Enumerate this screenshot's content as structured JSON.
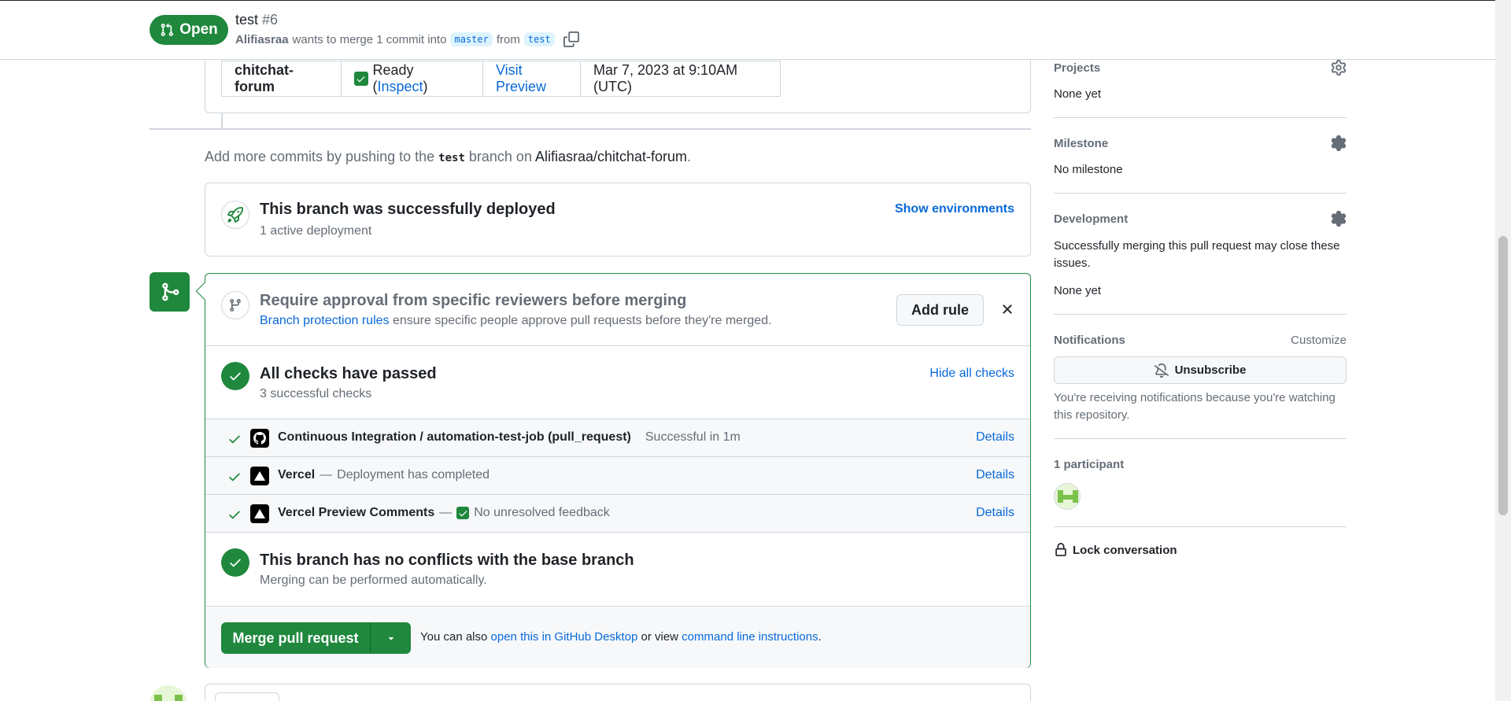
{
  "header": {
    "state": "Open",
    "title": "test",
    "number": "#6",
    "author": "Alifiasraa",
    "merge_text": "wants to merge 1 commit into",
    "base_branch": "master",
    "from_text": "from",
    "head_branch": "test"
  },
  "deployment_table": {
    "name": "chitchat-forum",
    "status_prefix": "Ready (",
    "inspect": "Inspect",
    "status_suffix": ")",
    "visit_preview": "Visit Preview",
    "date": "Mar 7, 2023 at 9:10AM (UTC)"
  },
  "push_hint": {
    "prefix": "Add more commits by pushing to the",
    "branch": "test",
    "middle": "branch on",
    "repo": "Alifiasraa/chitchat-forum",
    "suffix": "."
  },
  "deployed": {
    "title": "This branch was successfully deployed",
    "subtitle": "1 active deployment",
    "show_environments": "Show environments"
  },
  "rule": {
    "title": "Require approval from specific reviewers before merging",
    "link": "Branch protection rules",
    "description": "ensure specific people approve pull requests before they're merged.",
    "add_rule": "Add rule"
  },
  "checks": {
    "title": "All checks have passed",
    "subtitle": "3 successful checks",
    "hide_all": "Hide all checks",
    "rows": [
      {
        "name": "Continuous Integration / automation-test-job (pull_request)",
        "separator": "",
        "status": "Successful in 1m",
        "details": "Details"
      },
      {
        "name": "Vercel",
        "separator": "—",
        "status": "Deployment has completed",
        "details": "Details"
      },
      {
        "name": "Vercel Preview Comments",
        "separator": "—",
        "status": "No unresolved feedback",
        "details": "Details"
      }
    ]
  },
  "conflicts": {
    "title": "This branch has no conflicts with the base branch",
    "subtitle": "Merging can be performed automatically."
  },
  "merge": {
    "button": "Merge pull request",
    "hint_prefix": "You can also",
    "desktop_link": "open this in GitHub Desktop",
    "hint_middle": "or view",
    "cli_link": "command line instructions",
    "hint_suffix": "."
  },
  "sidebar": {
    "projects_label": "Projects",
    "projects_value": "None yet",
    "milestone_label": "Milestone",
    "milestone_value": "No milestone",
    "development_label": "Development",
    "development_desc": "Successfully merging this pull request may close these issues.",
    "development_value": "None yet",
    "notifications_label": "Notifications",
    "customize": "Customize",
    "unsubscribe": "Unsubscribe",
    "notifications_reason": "You're receiving notifications because you're watching this repository.",
    "participants": "1 participant",
    "lock": "Lock conversation"
  },
  "colors": {
    "success": "#1f883d",
    "link": "#0969da",
    "muted": "#656d76"
  }
}
